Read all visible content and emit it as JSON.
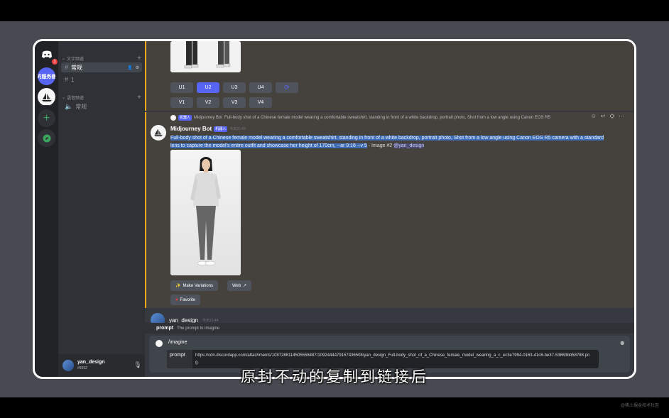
{
  "servers": {
    "badge_count": "1",
    "server_abbrev": "的服务器"
  },
  "channels": {
    "text_category": "文字频道",
    "voice_category": "语音频道",
    "items": [
      {
        "label": "常规"
      },
      {
        "label": "1"
      }
    ],
    "voice_items": [
      {
        "label": "常规"
      }
    ]
  },
  "user": {
    "name": "yan_design",
    "tag": "#6552"
  },
  "upscale_row1": [
    "U1",
    "U2",
    "U3",
    "U4"
  ],
  "variation_row1": [
    "V1",
    "V2",
    "V3",
    "V4"
  ],
  "upscale_row2": [],
  "variation_row2": [],
  "message": {
    "reply_author": "Midjourney Bot",
    "reply_badge": "机器人",
    "reply_text": "Full-body shot of a Chinese female model wearing a comfortable sweatshirt, standing in front of a white backdrop, portrait photo, Shot from a low angle using Canon EOS R5",
    "author": "Midjourney Bot",
    "bot_badge": "机器人",
    "timestamp": "今天21:43",
    "prompt_selected": "Full-body shot of a Chinese female model wearing a comfortable sweatshirt, standing in front of a white backdrop, portrait photo, Shot from a low angle using Canon EOS R5 camera with a standard lens to capture the model's entire outfit and showcase her height of 170cm, --ar 9:16 --v 5",
    "suffix": " - Image #2 ",
    "mention": "@yan_design",
    "make_variations": "Make Variations",
    "web": "Web",
    "favorite": "Favorite"
  },
  "second_message": {
    "author": "yan_design",
    "timestamp": "今天21:44"
  },
  "command_hint": {
    "option": "prompt",
    "description": "The prompt to imagine"
  },
  "composer": {
    "command": "/imagine",
    "option_label": "prompt",
    "option_value": "https://cdn.discordapp.com/attachments/1087288114505558487/1092444479157436508/yan_design_Full-body_shot_of_a_Chinese_female_model_wearing_a_c_ec3e7994-0163-41c8-be37-53863bb58788.png."
  },
  "subtitle": "原封不动的复制到链接后",
  "watermark": "@稀土掘金技术社区",
  "colors": {
    "blurple": "#5865f2",
    "highlight": "#faa81a",
    "selection": "#3e6db5"
  }
}
